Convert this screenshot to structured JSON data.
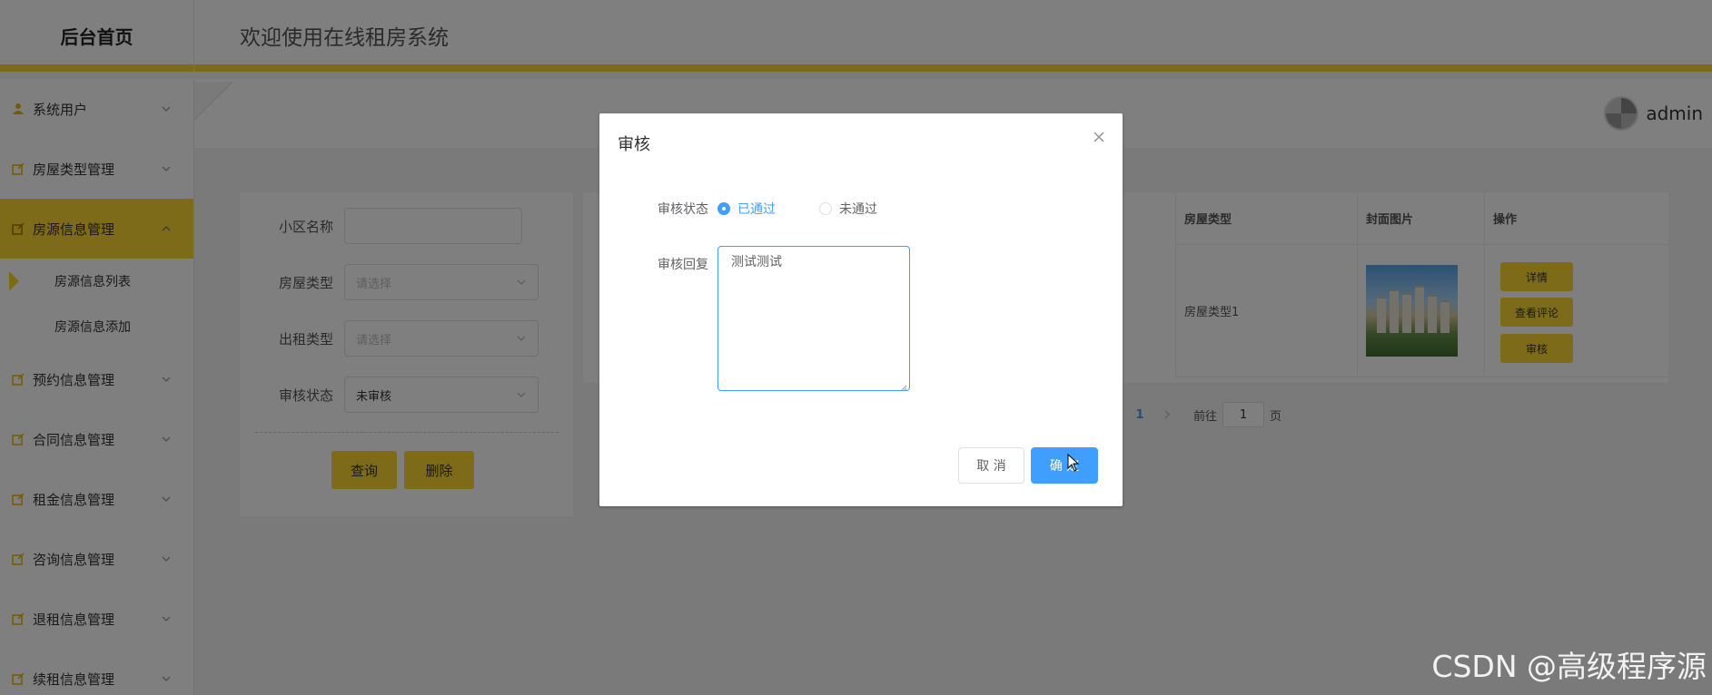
{
  "header": {
    "logo": "后台首页",
    "title": "欢迎使用在线租房系统"
  },
  "user": {
    "name": "admin"
  },
  "sidebar": {
    "items": [
      {
        "label": "系统用户",
        "icon": "user-icon"
      },
      {
        "label": "房屋类型管理",
        "icon": "edit-icon"
      },
      {
        "label": "房源信息管理",
        "icon": "edit-icon",
        "active": true
      },
      {
        "label": "预约信息管理",
        "icon": "edit-icon"
      },
      {
        "label": "合同信息管理",
        "icon": "edit-icon"
      },
      {
        "label": "租金信息管理",
        "icon": "edit-icon"
      },
      {
        "label": "咨询信息管理",
        "icon": "edit-icon"
      },
      {
        "label": "退租信息管理",
        "icon": "edit-icon"
      },
      {
        "label": "续租信息管理",
        "icon": "edit-icon"
      }
    ],
    "subitems": [
      {
        "label": "房源信息列表",
        "selected": true
      },
      {
        "label": "房源信息添加"
      }
    ]
  },
  "search": {
    "community_label": "小区名称",
    "community_value": "",
    "house_type_label": "房屋类型",
    "house_type_placeholder": "请选择",
    "rent_type_label": "出租类型",
    "rent_type_placeholder": "请选择",
    "audit_status_label": "审核状态",
    "audit_status_value": "未审核",
    "query_button": "查询",
    "delete_button": "删除"
  },
  "table": {
    "headers": {
      "house_type": "房屋类型",
      "cover_image": "封面图片",
      "actions": "操作"
    },
    "rows": [
      {
        "house_type": "房屋类型1",
        "actions": [
          "详情",
          "查看评论",
          "审核"
        ]
      }
    ]
  },
  "pagination": {
    "current_page": "1",
    "goto_prefix": "前往",
    "goto_value": "1",
    "goto_suffix": "页"
  },
  "dialog": {
    "title": "审核",
    "status_label": "审核状态",
    "options": [
      {
        "label": "已通过",
        "checked": true
      },
      {
        "label": "未通过",
        "checked": false
      }
    ],
    "reply_label": "审核回复",
    "reply_value": "测试测试",
    "cancel_button": "取 消",
    "confirm_button": "确 定"
  },
  "watermark": "CSDN @高级程序源",
  "colors": {
    "accent_yellow": "#fdd633",
    "primary_blue": "#409eff"
  }
}
